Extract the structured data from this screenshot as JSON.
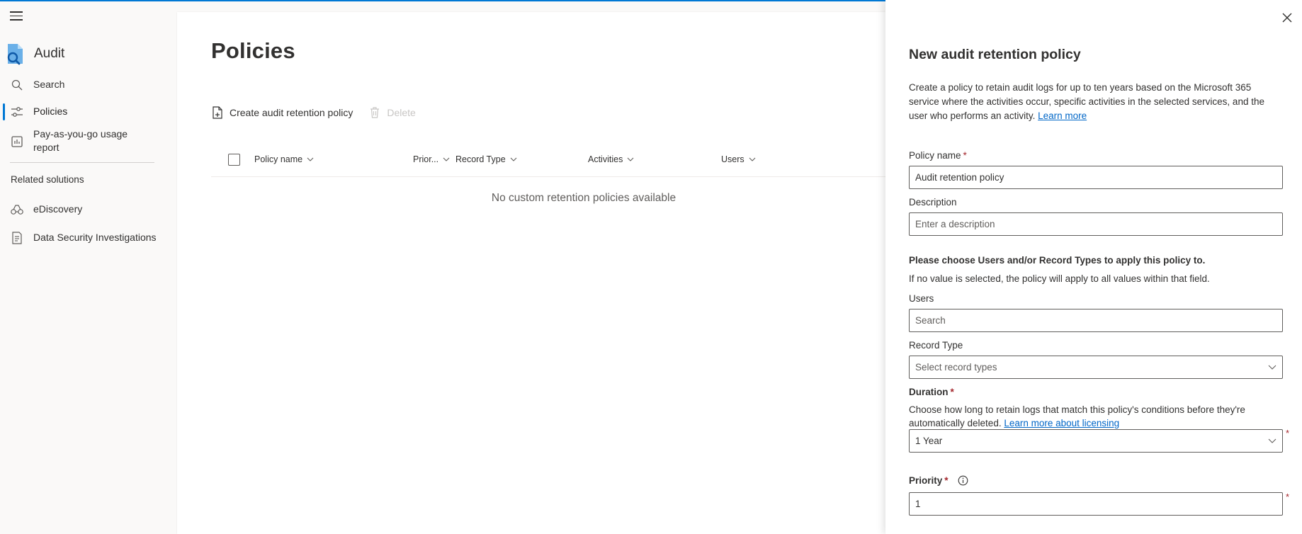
{
  "app": {
    "title": "Audit"
  },
  "nav": {
    "items": [
      {
        "label": "Search",
        "icon": "search-icon"
      },
      {
        "label": "Policies",
        "icon": "policies-icon",
        "active": true
      },
      {
        "label": "Pay-as-you-go usage report",
        "icon": "report-icon"
      }
    ],
    "related_title": "Related solutions",
    "related": [
      {
        "label": "eDiscovery",
        "icon": "ediscovery-icon"
      },
      {
        "label": "Data Security Investigations",
        "icon": "investigations-icon"
      }
    ]
  },
  "page": {
    "title": "Policies",
    "toolbar": {
      "create_label": "Create audit retention policy",
      "delete_label": "Delete"
    },
    "columns": [
      "Policy name",
      "Prior...",
      "Record Type",
      "Activities",
      "Users"
    ],
    "empty_message": "No custom retention policies available"
  },
  "panel": {
    "title": "New audit retention policy",
    "description": "Create a policy to retain audit logs for up to ten years based on the Microsoft 365 service where the activities occur, specific activities in the selected services, and the user who performs an activity.",
    "learn_more": "Learn more",
    "policy_name_label": "Policy name",
    "policy_name_value": "Audit retention policy",
    "description_label": "Description",
    "description_placeholder": "Enter a description",
    "choose_heading": "Please choose Users and/or Record Types to apply this policy to.",
    "choose_note": "If no value is selected, the policy will apply to all values within that field.",
    "users_label": "Users",
    "users_placeholder": "Search",
    "record_type_label": "Record Type",
    "record_type_placeholder": "Select record types",
    "duration_label": "Duration",
    "duration_desc": "Choose how long to retain logs that match this policy's conditions before they're automatically deleted.",
    "licensing_link": "Learn more about licensing",
    "duration_value": "1 Year",
    "priority_label": "Priority",
    "priority_value": "1",
    "required_mark": "*"
  },
  "colors": {
    "accent": "#0078d4",
    "link": "#0066c7",
    "required": "#a4262c"
  }
}
